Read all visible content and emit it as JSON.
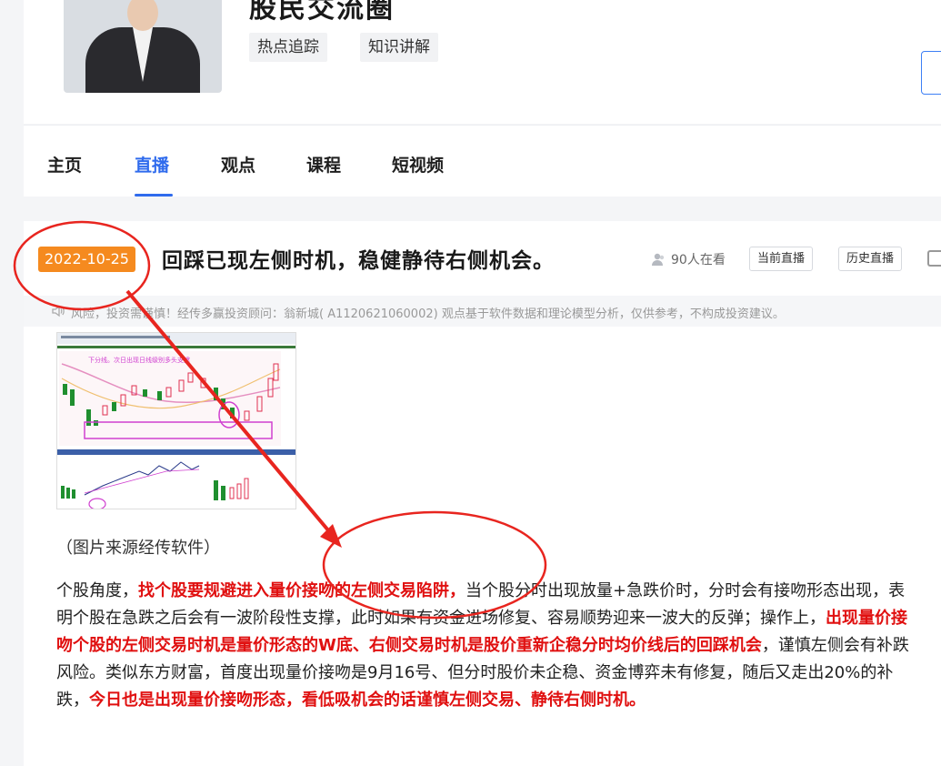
{
  "profile": {
    "anchor_name": "股民交流圈",
    "tags": [
      "热点追踪",
      "知识讲解"
    ]
  },
  "nav": {
    "tabs": [
      {
        "label": "主页",
        "active": false
      },
      {
        "label": "直播",
        "active": true
      },
      {
        "label": "观点",
        "active": false
      },
      {
        "label": "课程",
        "active": false
      },
      {
        "label": "短视频",
        "active": false
      }
    ]
  },
  "post": {
    "date": "2022-10-25",
    "title": "回踩已现左侧时机，稳健静待右侧机会。",
    "viewer_count": "90人在看",
    "current_live_label": "当前直播",
    "history_live_label": "历史直播",
    "risk_text": "风险，投资需谨慎！经传多赢投资顾问：翁新城( A1120621060002) 观点基于软件数据和理论模型分析，仅供参考，不构成投资建议。",
    "image_caption": "（图片来源经传软件）",
    "article": {
      "p1": "个股角度，",
      "h1": "找个股要规避进入量价接吻的左侧交易陷阱，",
      "p2": "当个股分时出现放量+急跌价时，分时会有接吻形态出现，表明个股在急跌之后会有一波阶段性支撑，此时如果有资金进场修复、容易顺势迎来一波大的反弹；操作上，",
      "h2": "出现量价接吻个股的左侧交易时机是量价形态的W底、右侧交易时机是股价重新企稳分时均价线后的回踩机会",
      "p3": "，谨慎左侧会有补跌风险。类似东方财富，首度出现量价接吻是9月16号、但分时股价未企稳、资金博弈未有修复，随后又走出20%的补跌，",
      "h3": "今日也是出现量价接吻形态，看低吸机会的话谨慎左侧交易、静待右侧时机。"
    }
  },
  "colors": {
    "accent": "#2f6bed",
    "date_badge": "#f58a1f",
    "highlight_text": "#e01010",
    "annotation": "#e8251f"
  },
  "icons": {
    "viewer": "user-icon",
    "risk": "speaker-icon",
    "more": "expand-icon"
  }
}
